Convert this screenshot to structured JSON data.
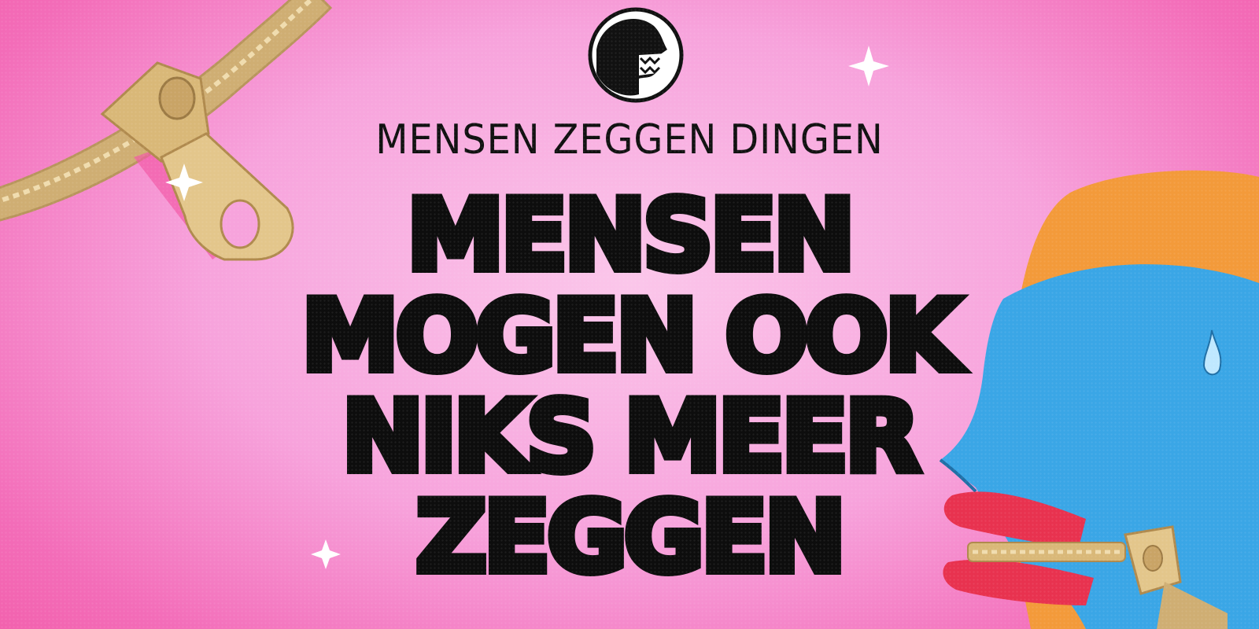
{
  "subtitle": "MENSEN ZEGGEN DINGEN",
  "headline": {
    "lines": [
      "MENSEN",
      "MOGEN OOK",
      "NIKS MEER",
      "ZEGGEN"
    ]
  },
  "icons": {
    "logo": "talking-head-zipper-mouth-icon",
    "zipper_left": "zipper-pull-icon",
    "face_right": "blue-face-zipped-mouth-illustration",
    "sparkles": "sparkle-icon"
  },
  "colors": {
    "background_center": "#fbc6ea",
    "background_edge": "#f25aa6",
    "text": "#0d0d0d",
    "zipper_gold": "#d9b878",
    "face_blue": "#3aa6e6",
    "hair_orange": "#f39a3a",
    "tongue_red": "#e8324f"
  }
}
